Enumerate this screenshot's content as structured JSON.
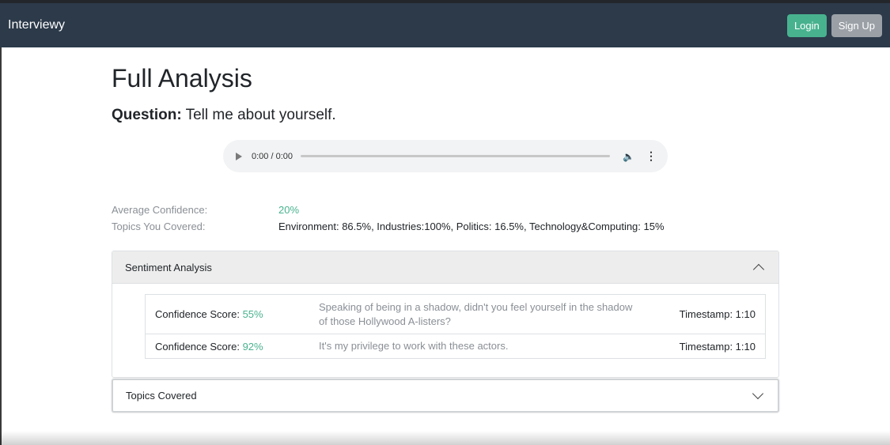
{
  "navbar": {
    "brand": "Interviewy",
    "login_label": "Login",
    "signup_label": "Sign Up"
  },
  "page": {
    "title": "Full Analysis",
    "question_label": "Question:",
    "question_text": "Tell me about yourself."
  },
  "audio": {
    "time": "0:00 / 0:00",
    "progress": 0
  },
  "stats": {
    "avg_confidence_label": "Average Confidence:",
    "avg_confidence_value": "20%",
    "topics_label": "Topics You Covered:",
    "topics_value": "Environment: 86.5%, Industries:100%, Politics: 16.5%, Technology&Computing: 15%"
  },
  "sentiment": {
    "header": "Sentiment Analysis",
    "expanded": true,
    "rows": [
      {
        "score_label": "Confidence Score:",
        "score_value": "55%",
        "text": "Speaking of being in a shadow, didn't you feel yourself in the shadow of those Hollywood A-listers?",
        "timestamp": "Timestamp: 1:10"
      },
      {
        "score_label": "Confidence Score:",
        "score_value": "92%",
        "text": "It's my privilege to work with these actors.",
        "timestamp": "Timestamp: 1:10"
      }
    ]
  },
  "topics_covered": {
    "header": "Topics Covered",
    "expanded": false
  },
  "colors": {
    "navbar": "#2c3a4a",
    "accent_green": "#48b28f",
    "signup_gray": "#9aa0a6"
  },
  "icons": {
    "play": "play-icon",
    "volume": "volume-icon",
    "more": "more-vert-icon",
    "collapse": "chevron-up-icon",
    "expand": "chevron-down-icon"
  }
}
